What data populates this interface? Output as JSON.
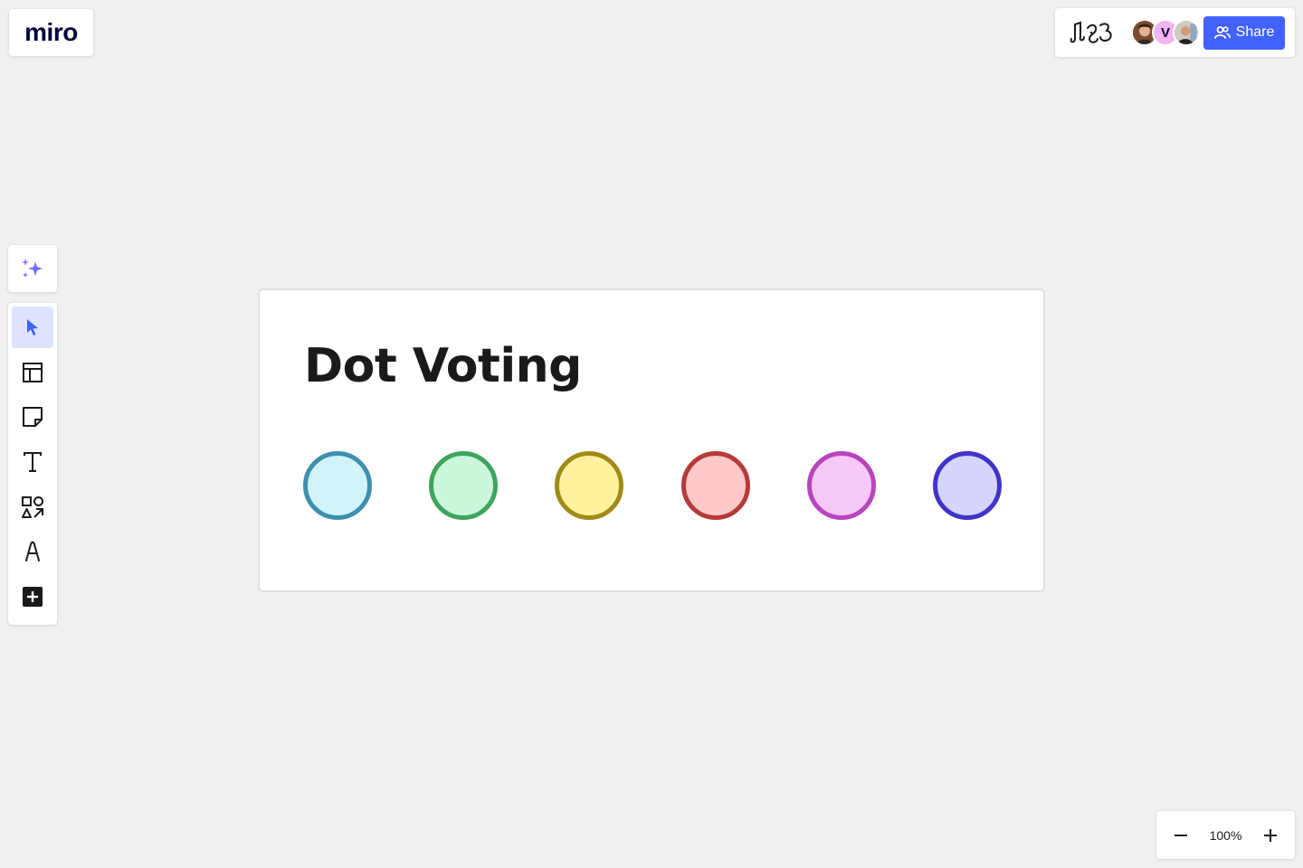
{
  "app": {
    "logo_text": "miro"
  },
  "collab": {
    "reactions_icon": "reactions-icon",
    "avatars": [
      {
        "initial": ""
      },
      {
        "initial": "V"
      },
      {
        "initial": ""
      }
    ],
    "share_label": "Share"
  },
  "toolbar": {
    "tools": [
      {
        "name": "select",
        "icon": "cursor-icon",
        "active": true
      },
      {
        "name": "templates",
        "icon": "templates-icon"
      },
      {
        "name": "sticky-note",
        "icon": "sticky-note-icon"
      },
      {
        "name": "text",
        "icon": "text-icon"
      },
      {
        "name": "shapes",
        "icon": "shapes-icon"
      },
      {
        "name": "pen",
        "icon": "pen-icon"
      },
      {
        "name": "more",
        "icon": "plus-square-icon"
      }
    ]
  },
  "frame": {
    "title": "Dot Voting",
    "dots": [
      {
        "name": "blue",
        "fill": "#d1f4fb",
        "stroke": "#3f8fae"
      },
      {
        "name": "green",
        "fill": "#cbf7dd",
        "stroke": "#3ea45d"
      },
      {
        "name": "yellow",
        "fill": "#fff29e",
        "stroke": "#a08b17"
      },
      {
        "name": "red",
        "fill": "#ffc9c9",
        "stroke": "#b53b3b"
      },
      {
        "name": "pink",
        "fill": "#f6c9f6",
        "stroke": "#b844c0"
      },
      {
        "name": "indigo",
        "fill": "#d5d5fd",
        "stroke": "#4134c9"
      }
    ]
  },
  "zoom": {
    "level": "100%"
  },
  "colors": {
    "accent": "#4262ff",
    "canvas": "#f0f0f0"
  }
}
